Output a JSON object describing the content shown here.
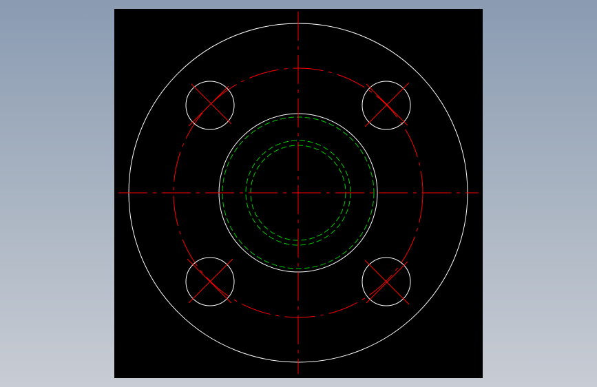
{
  "colors": {
    "background": "#000000",
    "outline": "#ffffff",
    "centerline": "#ff0000",
    "hidden": "#00cc00",
    "desktop_top": "#8a9bb2",
    "desktop_bottom": "#c8ccd4"
  },
  "drawing": {
    "view": "flange-top-view",
    "bolt_holes": 4,
    "line_types": [
      "continuous",
      "center",
      "hidden"
    ]
  }
}
